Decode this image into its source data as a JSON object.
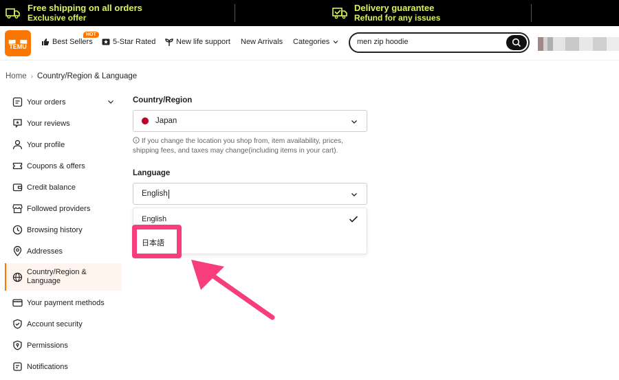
{
  "promo": {
    "shipping_title": "Free shipping on all orders",
    "shipping_sub": "Exclusive offer",
    "delivery_title": "Delivery guarantee",
    "delivery_sub": "Refund for any issues"
  },
  "header": {
    "logo_line1": "▄▖▗▄",
    "logo_line2": "TEMU",
    "nav": {
      "best_sellers": "Best Sellers",
      "hot_badge": "HOT",
      "five_star": "5-Star Rated",
      "new_life": "New life support",
      "new_arrivals": "New Arrivals",
      "categories": "Categories"
    },
    "search_value": "men zip hoodie"
  },
  "breadcrumb": {
    "home": "Home",
    "current": "Country/Region & Language"
  },
  "sidebar": {
    "items": [
      {
        "label": "Your orders",
        "icon": "orders-icon"
      },
      {
        "label": "Your reviews",
        "icon": "reviews-icon"
      },
      {
        "label": "Your profile",
        "icon": "profile-icon"
      },
      {
        "label": "Coupons & offers",
        "icon": "coupon-icon"
      },
      {
        "label": "Credit balance",
        "icon": "wallet-icon"
      },
      {
        "label": "Followed providers",
        "icon": "store-icon"
      },
      {
        "label": "Browsing history",
        "icon": "clock-icon"
      },
      {
        "label": "Addresses",
        "icon": "location-icon"
      },
      {
        "label": "Country/Region & Language",
        "icon": "globe-icon"
      },
      {
        "label": "Your payment methods",
        "icon": "card-icon"
      },
      {
        "label": "Account security",
        "icon": "shield-icon"
      },
      {
        "label": "Permissions",
        "icon": "permission-icon"
      },
      {
        "label": "Notifications",
        "icon": "bell-icon"
      }
    ]
  },
  "main": {
    "country_label": "Country/Region",
    "country_value": "Japan",
    "country_note": "If you change the location you shop from, item availability, prices, shipping fees, and taxes may change(including items in your cart).",
    "language_label": "Language",
    "language_value": "English",
    "options": [
      "English",
      "日本語"
    ]
  },
  "colors": {
    "accent": "#fb7701",
    "promo_text": "#d7f55a",
    "annotation": "#f83d7d"
  }
}
